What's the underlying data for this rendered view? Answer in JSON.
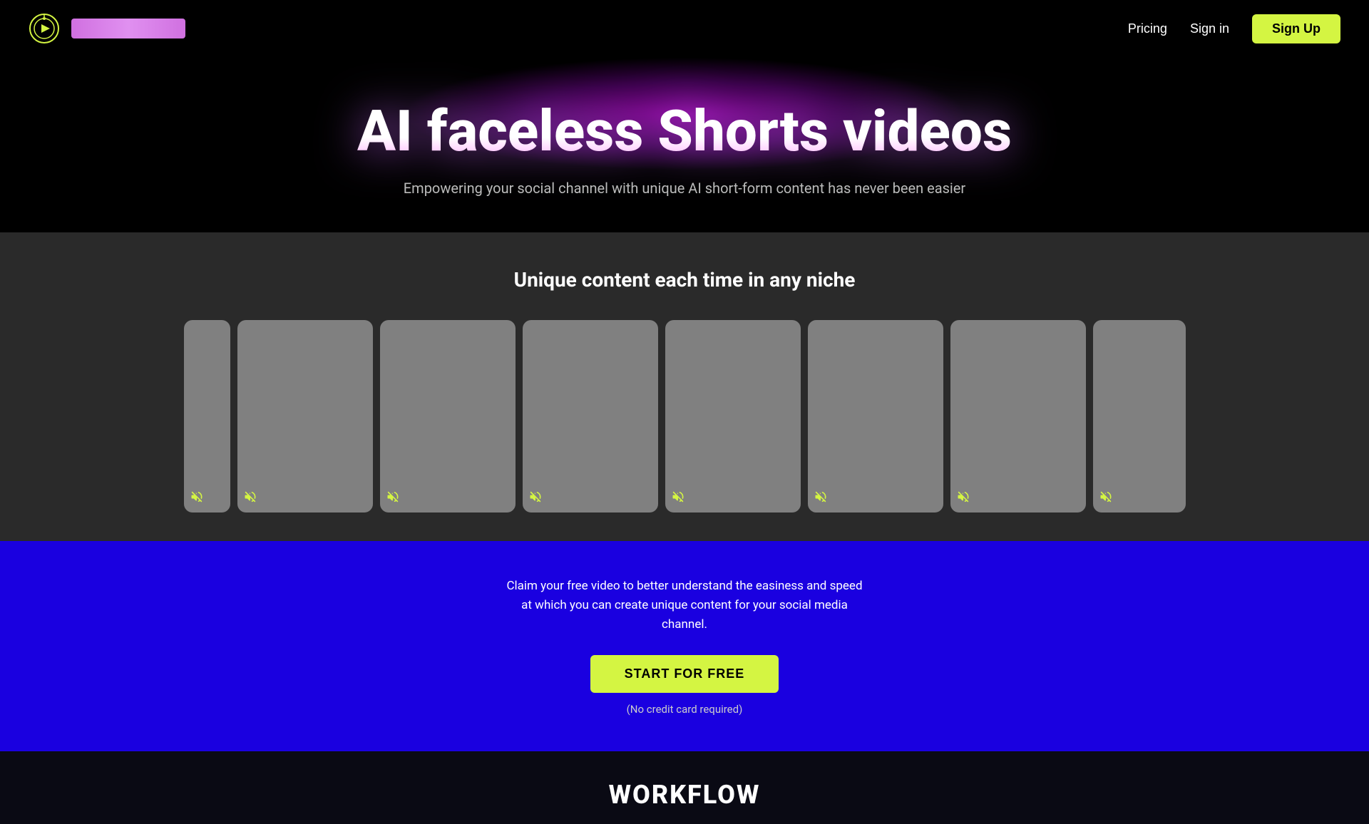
{
  "navbar": {
    "logo_alt": "AI Video Logo",
    "logo_text_placeholder": "",
    "pricing_label": "Pricing",
    "signin_label": "Sign in",
    "signup_label": "Sign Up"
  },
  "hero": {
    "title": "AI faceless Shorts videos",
    "subtitle": "Empowering your social channel with unique AI short-form content has never been easier"
  },
  "video_section": {
    "title": "Unique content each time in any niche",
    "cards": [
      {
        "id": 1,
        "muted": true
      },
      {
        "id": 2,
        "muted": true
      },
      {
        "id": 3,
        "muted": true
      },
      {
        "id": 4,
        "muted": true
      },
      {
        "id": 5,
        "muted": true
      },
      {
        "id": 6,
        "muted": true
      },
      {
        "id": 7,
        "muted": true
      },
      {
        "id": 8,
        "muted": true
      }
    ]
  },
  "cta_section": {
    "description": "Claim your free video to better understand the easiness and speed at which you can create unique content for your social media channel.",
    "button_label": "START FOR FREE",
    "note": "(No credit card required)"
  },
  "workflow_section": {
    "title": "WORKFLOW"
  },
  "colors": {
    "accent_green": "#d4f542",
    "cta_bg": "#1a00e0",
    "hero_glow": "#b000c8"
  }
}
